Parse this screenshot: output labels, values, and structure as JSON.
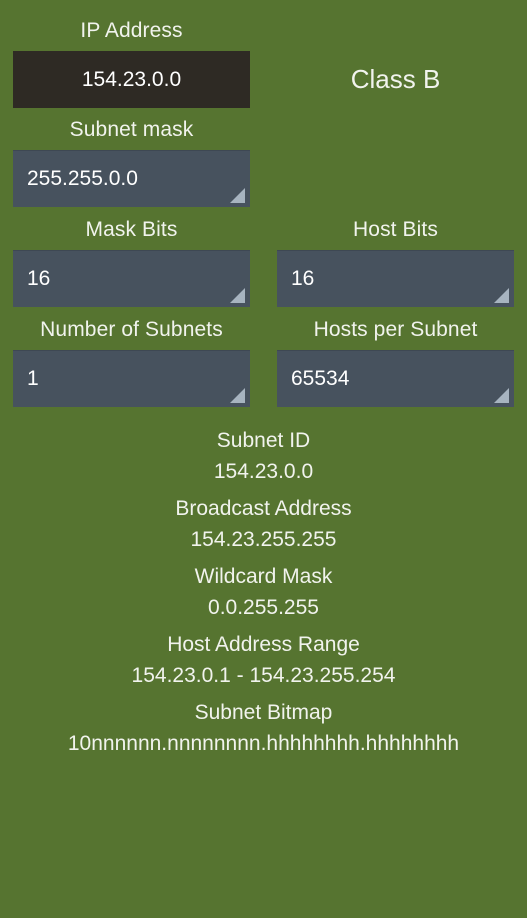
{
  "fields": {
    "ip_address": {
      "label": "IP Address",
      "value": "154.23.0.0"
    },
    "ip_class": {
      "value": "Class B"
    },
    "subnet_mask": {
      "label": "Subnet mask",
      "value": "255.255.0.0"
    },
    "mask_bits": {
      "label": "Mask Bits",
      "value": "16"
    },
    "host_bits": {
      "label": "Host Bits",
      "value": "16"
    },
    "number_of_subnets": {
      "label": "Number of Subnets",
      "value": "1"
    },
    "hosts_per_subnet": {
      "label": "Hosts per Subnet",
      "value": "65534"
    }
  },
  "results": [
    {
      "label": "Subnet ID",
      "value": "154.23.0.0"
    },
    {
      "label": "Broadcast Address",
      "value": "154.23.255.255"
    },
    {
      "label": "Wildcard Mask",
      "value": "0.0.255.255"
    },
    {
      "label": "Host Address Range",
      "value": "154.23.0.1 - 154.23.255.254"
    },
    {
      "label": "Subnet Bitmap",
      "value": "10nnnnnn.nnnnnnnn.hhhhhhhh.hhhhhhhh"
    }
  ],
  "icons": {
    "spinner_caret": "dropdown-triangle-icon"
  },
  "colors": {
    "background": "#567430",
    "edit_text_bg": "#2E2A24",
    "spinner_bg": "#47525E",
    "caret": "#A7B4C0",
    "text": "#F1F3ED"
  }
}
